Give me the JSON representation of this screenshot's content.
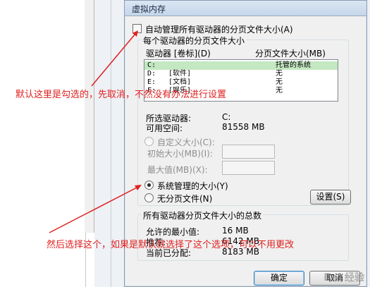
{
  "dialog": {
    "title": "虚拟内存",
    "auto_manage_label": "自动管理所有驱动器的分页文件大小(A)",
    "group_each_drive": "每个驱动器的分页文件大小",
    "col_drive": "驱动器 [卷标](D)",
    "col_size": "分页文件大小(MB)",
    "drives": [
      {
        "drive": "C:",
        "label": "",
        "size": "托管的系统",
        "selected": true
      },
      {
        "drive": "D:",
        "label": "[软件]",
        "size": "无",
        "selected": false
      },
      {
        "drive": "E:",
        "label": "[文档]",
        "size": "无",
        "selected": false
      },
      {
        "drive": "F:",
        "label": "[娱乐]",
        "size": "无",
        "selected": false
      }
    ],
    "selected_drive_label": "所选驱动器:",
    "selected_drive_value": "C:",
    "free_space_label": "可用空间:",
    "free_space_value": "81558 MB",
    "custom_size_label": "自定义大小(C):",
    "initial_size_label": "初始大小(MB)(I):",
    "max_size_label": "最大值(MB)(X):",
    "system_managed_label": "系统管理的大小(Y)",
    "no_paging_label": "无分页文件(N)",
    "set_button": "设置(S)",
    "total_group": "所有驱动器分页文件大小的总数",
    "min_allowed_label": "允许的最小值:",
    "min_allowed_value": "16 MB",
    "recommended_label": "推荐:",
    "recommended_value": "6142 MB",
    "current_label": "当前已分配:",
    "current_value": "8183 MB",
    "ok_button": "确定",
    "cancel_button": "取消"
  },
  "annotations": {
    "top": "默认这里是勾选的，先取消，不然没有办法进行设置",
    "bottom": "然后选择这个，如果是默认就选择了这个选项，可以不用更改"
  },
  "watermark": "Bai 经验",
  "colors": {
    "annotation": "#e02020",
    "selected_row": "#c4e8c1"
  }
}
